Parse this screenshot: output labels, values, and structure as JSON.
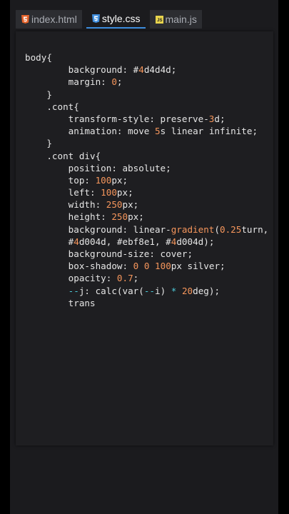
{
  "tabs": [
    {
      "label": "index.html",
      "icon": "html5-icon",
      "active": false
    },
    {
      "label": "style.css",
      "icon": "css3-icon",
      "active": true
    },
    {
      "label": "main.js",
      "icon": "js-icon",
      "active": false
    }
  ],
  "colors": {
    "background": "#000000",
    "editor_bg": "#1e1e21",
    "text": "#e6e6e6",
    "number": "#f6965c",
    "operator": "#4dc9d8",
    "tab_accent": "#3e8ddd",
    "html_icon": "#e4632b",
    "css_icon": "#3e8ddd",
    "js_icon": "#e8d44d"
  },
  "code_lines": [
    [
      {
        "t": "body{"
      }
    ],
    [
      {
        "t": "        background: #"
      },
      {
        "t": "4",
        "k": "num"
      },
      {
        "t": "d4d4d;"
      }
    ],
    [
      {
        "t": "        margin: "
      },
      {
        "t": "0",
        "k": "num"
      },
      {
        "t": ";"
      }
    ],
    [
      {
        "t": "    }"
      }
    ],
    [
      {
        "t": "    .cont{"
      }
    ],
    [
      {
        "t": "        transform-style: preserve-"
      },
      {
        "t": "3",
        "k": "num"
      },
      {
        "t": "d;"
      }
    ],
    [
      {
        "t": "        animation: move "
      },
      {
        "t": "5",
        "k": "num"
      },
      {
        "t": "s linear infinite;"
      }
    ],
    [
      {
        "t": "    }"
      }
    ],
    [
      {
        "t": "    .cont div{"
      }
    ],
    [
      {
        "t": "        position: absolute;"
      }
    ],
    [
      {
        "t": "        top: "
      },
      {
        "t": "100",
        "k": "num"
      },
      {
        "t": "px;"
      }
    ],
    [
      {
        "t": "        left: "
      },
      {
        "t": "100",
        "k": "num"
      },
      {
        "t": "px;"
      }
    ],
    [
      {
        "t": "        width: "
      },
      {
        "t": "250",
        "k": "num"
      },
      {
        "t": "px;"
      }
    ],
    [
      {
        "t": "        height: "
      },
      {
        "t": "250",
        "k": "num"
      },
      {
        "t": "px;"
      }
    ],
    [
      {
        "t": "        background: linear-"
      },
      {
        "t": "gradient",
        "k": "num"
      },
      {
        "t": "("
      },
      {
        "t": "0.25",
        "k": "num"
      },
      {
        "t": "turn,"
      }
    ],
    [
      {
        "t": "        #"
      },
      {
        "t": "4",
        "k": "num"
      },
      {
        "t": "d004d, #ebf8e1, #"
      },
      {
        "t": "4",
        "k": "num"
      },
      {
        "t": "d004d);"
      }
    ],
    [
      {
        "t": "        background-size: cover;"
      }
    ],
    [
      {
        "t": "        box-shadow: "
      },
      {
        "t": "0",
        "k": "num"
      },
      {
        "t": " "
      },
      {
        "t": "0",
        "k": "num"
      },
      {
        "t": " "
      },
      {
        "t": "100",
        "k": "num"
      },
      {
        "t": "px silver;"
      }
    ],
    [
      {
        "t": "        opacity: "
      },
      {
        "t": "0.7",
        "k": "num"
      },
      {
        "t": ";"
      }
    ],
    [
      {
        "t": "        "
      },
      {
        "t": "--",
        "k": "op"
      },
      {
        "t": "j: calc(var("
      },
      {
        "t": "--",
        "k": "op"
      },
      {
        "t": "i) "
      },
      {
        "t": "*",
        "k": "op"
      },
      {
        "t": " "
      },
      {
        "t": "20",
        "k": "num"
      },
      {
        "t": "deg);"
      }
    ],
    [
      {
        "t": "        trans"
      }
    ]
  ]
}
